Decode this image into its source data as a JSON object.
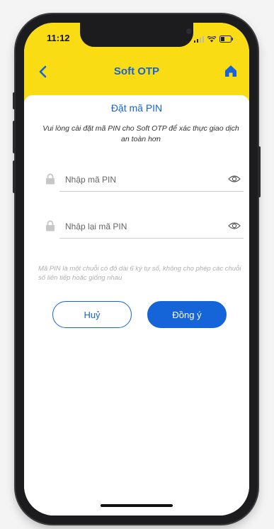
{
  "status_bar": {
    "time": "11:12"
  },
  "nav": {
    "title": "Soft OTP",
    "back_icon": "chevron-left-icon",
    "home_icon": "home-icon"
  },
  "page": {
    "title": "Đặt mã PIN",
    "instruction": "Vui lòng cài đặt mã PIN cho Soft OTP để xác thực giao dịch an toàn hơn"
  },
  "fields": [
    {
      "placeholder": "Nhập mã PIN",
      "value": ""
    },
    {
      "placeholder": "Nhập lại mã PIN",
      "value": ""
    }
  ],
  "note": "Mã PIN là một chuỗi có độ dài 6 ký tự số, không cho phép các chuỗi số liên tiếp hoặc giống nhau",
  "buttons": {
    "cancel_label": "Huỷ",
    "confirm_label": "Đồng ý"
  },
  "colors": {
    "header_yellow": "#fadc14",
    "primary_blue": "#1565d8"
  }
}
